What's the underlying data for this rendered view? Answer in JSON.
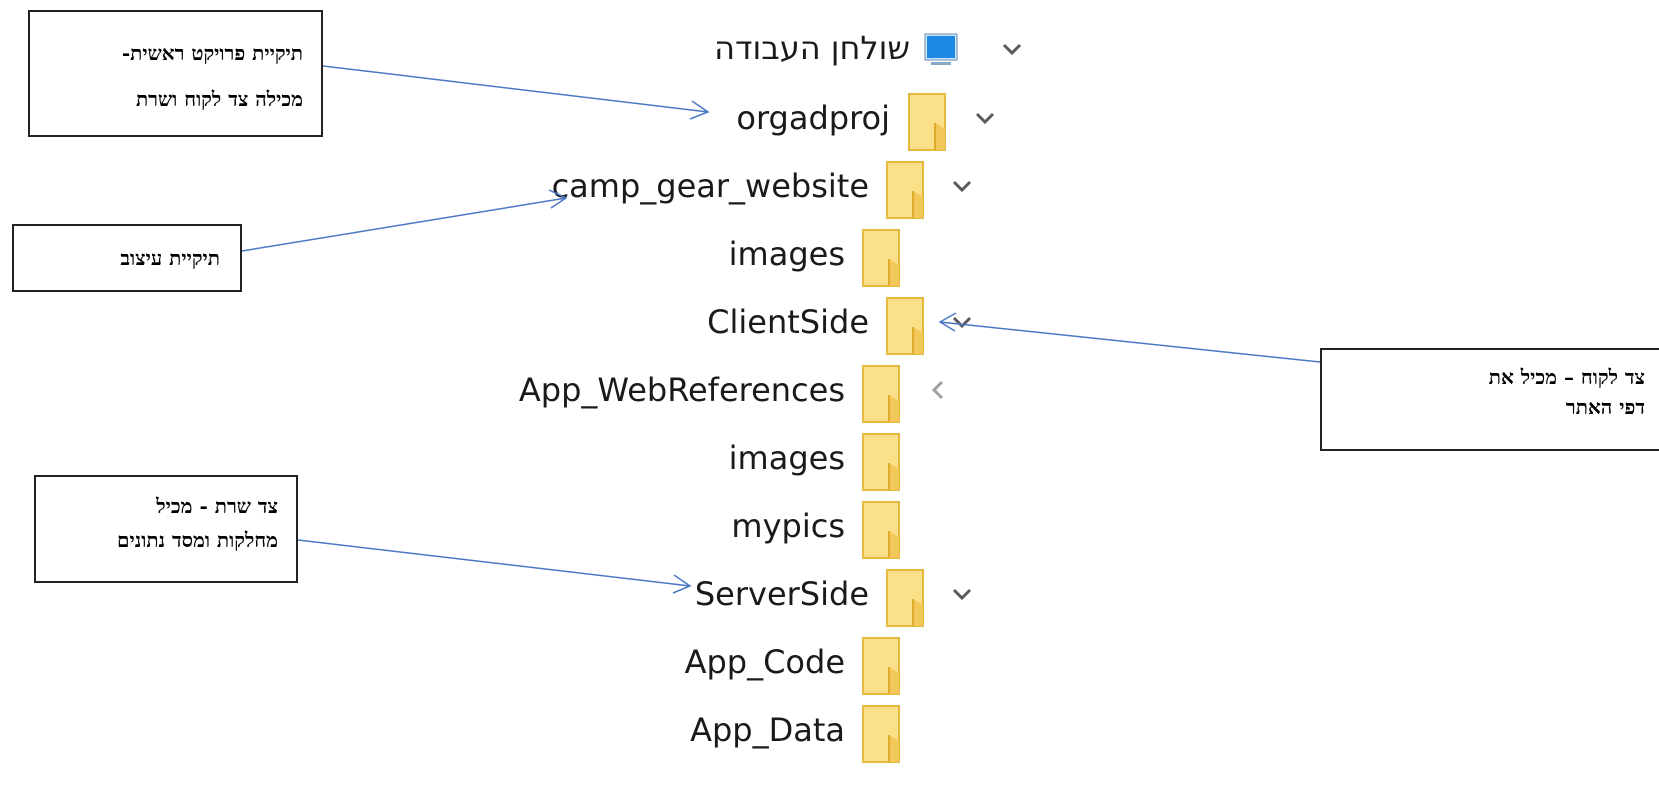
{
  "tree": {
    "desktop_label": "שולחן העבודה",
    "items": [
      {
        "label": "orgadproj",
        "expander": "chevron-down"
      },
      {
        "label": "camp_gear_website",
        "expander": "chevron-down"
      },
      {
        "label": "images",
        "expander": "none"
      },
      {
        "label": "ClientSide",
        "expander": "chevron-down"
      },
      {
        "label": "App_WebReferences",
        "expander": "chevron-left"
      },
      {
        "label": "images",
        "expander": "none"
      },
      {
        "label": "mypics",
        "expander": "none"
      },
      {
        "label": "ServerSide",
        "expander": "chevron-down"
      },
      {
        "label": "App_Code",
        "expander": "none"
      },
      {
        "label": "App_Data",
        "expander": "none"
      }
    ]
  },
  "callouts": {
    "main_folder": {
      "line1": "תיקיית פרויקט ראשית-",
      "line2": "מכילה צד לקוח ושרת"
    },
    "design_folder": {
      "line1": "תיקיית עיצוב"
    },
    "client_side": {
      "line1": "צד לקוח – מכיל את",
      "line2": "דפי האתר"
    },
    "server_side": {
      "line1": "צד שרת - מכיל",
      "line2": "מחלקות ומסד נתונים"
    }
  },
  "colors": {
    "folder_fill": "#fbe08a",
    "folder_edge": "#e5b93c",
    "folder_tab": "#f2c75a",
    "monitor_blue": "#1e88e5",
    "arrow": "#4a78c4",
    "chevron": "#5a5a5a",
    "chevron_light": "#a0a0a0"
  }
}
